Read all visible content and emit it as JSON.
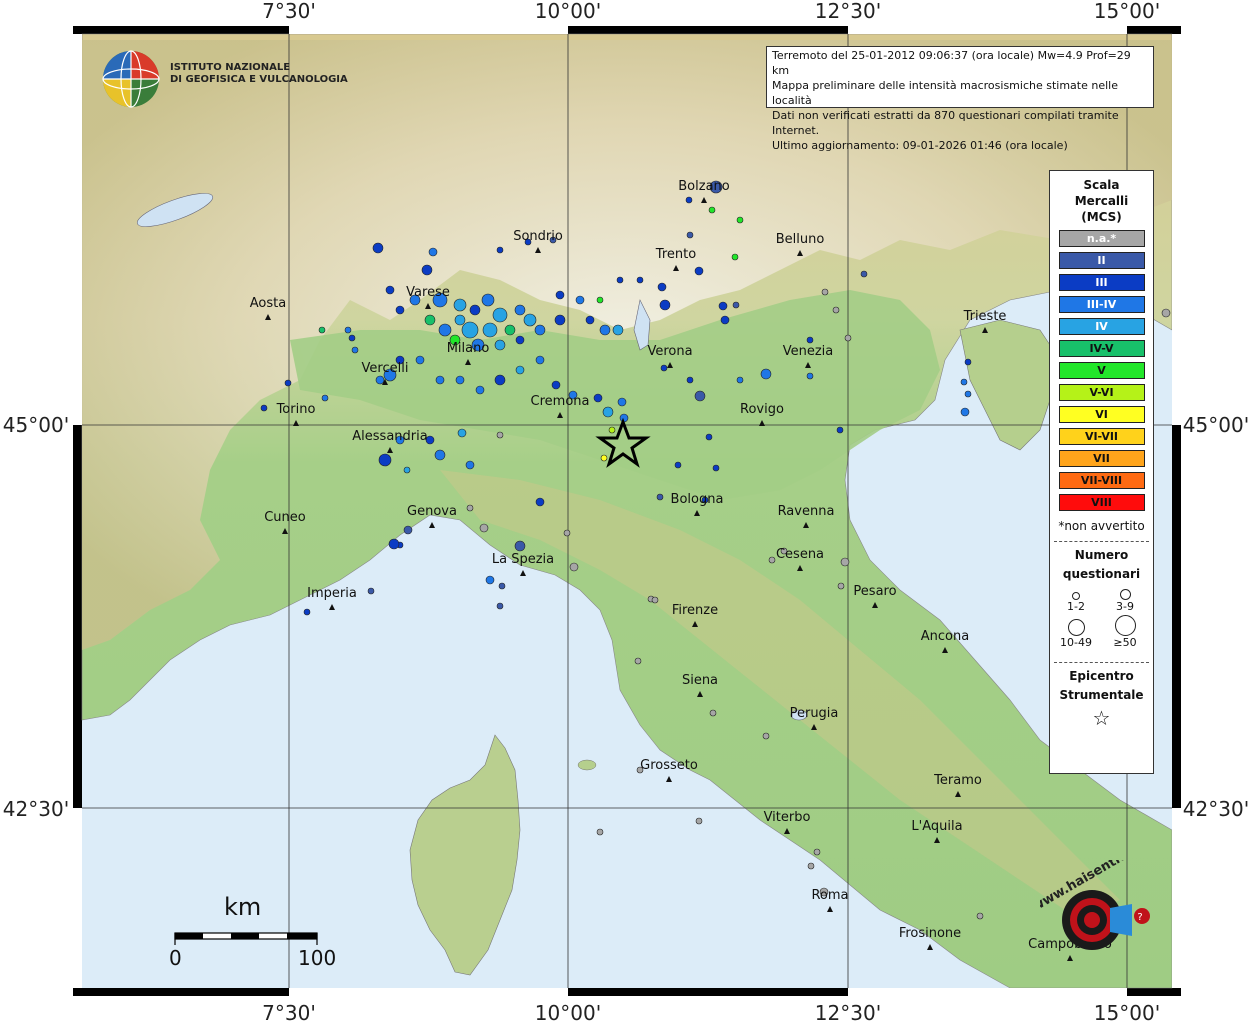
{
  "info": {
    "line1": "Terremoto del 25-01-2012 09:06:37 (ora locale) Mw=4.9 Prof=29 km",
    "line2": "Mappa preliminare delle intensità macrosismiche stimate nelle località",
    "line3": "Dati non verificati estratti da 870 questionari compilati tramite Internet.",
    "line4": "Ultimo aggiornamento: 09-01-2026 01:46 (ora locale)"
  },
  "logo": {
    "line1": "ISTITUTO NAZIONALE",
    "line2": "DI GEOFISICA E VULCANOLOGIA",
    "haisentito_text": "www.haisentitoilterremoto.it"
  },
  "axes": {
    "top_left": "7°30'",
    "top_mid": "10°00'",
    "top_right1": "12°30'",
    "top_right2": "15°00'",
    "lat_upper": "45°00'",
    "lat_lower": "42°30'"
  },
  "legend": {
    "title1": "Scala",
    "title2": "Mercalli",
    "title3": "(MCS)",
    "classes": [
      {
        "label": "n.a.*",
        "color": "#a6a6a6"
      },
      {
        "label": "II",
        "color": "#3a59a8"
      },
      {
        "label": "III",
        "color": "#0b3cc4"
      },
      {
        "label": "III-IV",
        "color": "#1f77e6"
      },
      {
        "label": "IV",
        "color": "#28a3e3"
      },
      {
        "label": "IV-V",
        "color": "#18c06a"
      },
      {
        "label": "V",
        "color": "#22e62a"
      },
      {
        "label": "V-VI",
        "color": "#b5f218"
      },
      {
        "label": "VI",
        "color": "#ffff22"
      },
      {
        "label": "VI-VII",
        "color": "#ffd21b"
      },
      {
        "label": "VII",
        "color": "#ffa41b"
      },
      {
        "label": "VII-VIII",
        "color": "#ff6a12"
      },
      {
        "label": "VIII",
        "color": "#ff0c0c"
      }
    ],
    "note": "*non avvertito",
    "numero1": "Numero",
    "numero2": "questionari",
    "size_labels": [
      "1-2",
      "3-9",
      "10-49",
      "≥50"
    ],
    "epi1": "Epicentro",
    "epi2": "Strumentale"
  },
  "scalebar": {
    "unit": "km",
    "start": "0",
    "end": "100"
  },
  "cities": [
    {
      "name": "Bolzano"
    },
    {
      "name": "Sondrio"
    },
    {
      "name": "Trento"
    },
    {
      "name": "Belluno"
    },
    {
      "name": "Aosta"
    },
    {
      "name": "Varese"
    },
    {
      "name": "Trieste"
    },
    {
      "name": "Milano"
    },
    {
      "name": "Verona"
    },
    {
      "name": "Venezia"
    },
    {
      "name": "Vercelli"
    },
    {
      "name": "Cremona"
    },
    {
      "name": "Torino"
    },
    {
      "name": "Rovigo"
    },
    {
      "name": "Alessandria"
    },
    {
      "name": "Bologna"
    },
    {
      "name": "Ravenna"
    },
    {
      "name": "Cuneo"
    },
    {
      "name": "Genova"
    },
    {
      "name": "Cesena"
    },
    {
      "name": "La Spezia"
    },
    {
      "name": "Imperia"
    },
    {
      "name": "Pesaro"
    },
    {
      "name": "Firenze"
    },
    {
      "name": "Ancona"
    },
    {
      "name": "Siena"
    },
    {
      "name": "Perugia"
    },
    {
      "name": "Grosseto"
    },
    {
      "name": "Teramo"
    },
    {
      "name": "Viterbo"
    },
    {
      "name": "L'Aquila"
    },
    {
      "name": "Roma"
    },
    {
      "name": "Frosinone"
    },
    {
      "name": "Campobasso"
    }
  ],
  "colors": {
    "sea": "#dcecf8",
    "lowland": "#a8cf86",
    "hills": "#cbc587",
    "mountains": "#ffffff"
  }
}
